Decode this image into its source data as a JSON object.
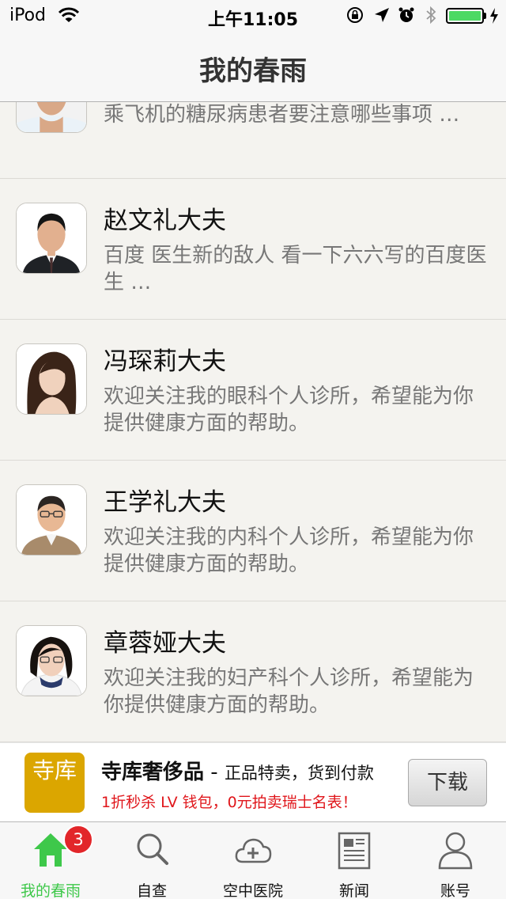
{
  "status_bar": {
    "carrier": "iPod",
    "time": "上午11:05",
    "battery_level": 1.0,
    "icons": [
      "wifi-icon",
      "rotation-lock-icon",
      "location-icon",
      "alarm-icon",
      "bluetooth-icon",
      "battery-icon",
      "charging-icon"
    ]
  },
  "nav": {
    "title": "我的春雨"
  },
  "doctors": [
    {
      "name": "",
      "desc": "乘飞机的糖尿病患者要注意哪些事项 …"
    },
    {
      "name": "赵文礼大夫",
      "desc": "百度 医生新的敌人 看一下六六写的百度医生 …"
    },
    {
      "name": "冯琛莉大夫",
      "desc": "欢迎关注我的眼科个人诊所，希望能为你提供健康方面的帮助。"
    },
    {
      "name": "王学礼大夫",
      "desc": "欢迎关注我的内科个人诊所，希望能为你提供健康方面的帮助。"
    },
    {
      "name": "章蓉娅大夫",
      "desc": "欢迎关注我的妇产科个人诊所，希望能为你提供健康方面的帮助。"
    }
  ],
  "ad": {
    "logo_text": "寺库",
    "brand": "寺库奢侈品",
    "separator": " - ",
    "tagline": "正品特卖，货到付款",
    "desc": "1折秒杀 LV 钱包，0元拍卖瑞士名表！",
    "button": "下载",
    "colors": {
      "logo_bg": "#dba600",
      "desc": "#e0161b"
    }
  },
  "tabs": [
    {
      "label": "我的春雨",
      "icon": "home-icon",
      "badge": "3",
      "active": true
    },
    {
      "label": "自查",
      "icon": "search-icon"
    },
    {
      "label": "空中医院",
      "icon": "cloud-plus-icon"
    },
    {
      "label": "新闻",
      "icon": "news-icon"
    },
    {
      "label": "账号",
      "icon": "user-icon"
    }
  ],
  "colors": {
    "accent": "#3ec84a",
    "badge": "#e2262a"
  }
}
